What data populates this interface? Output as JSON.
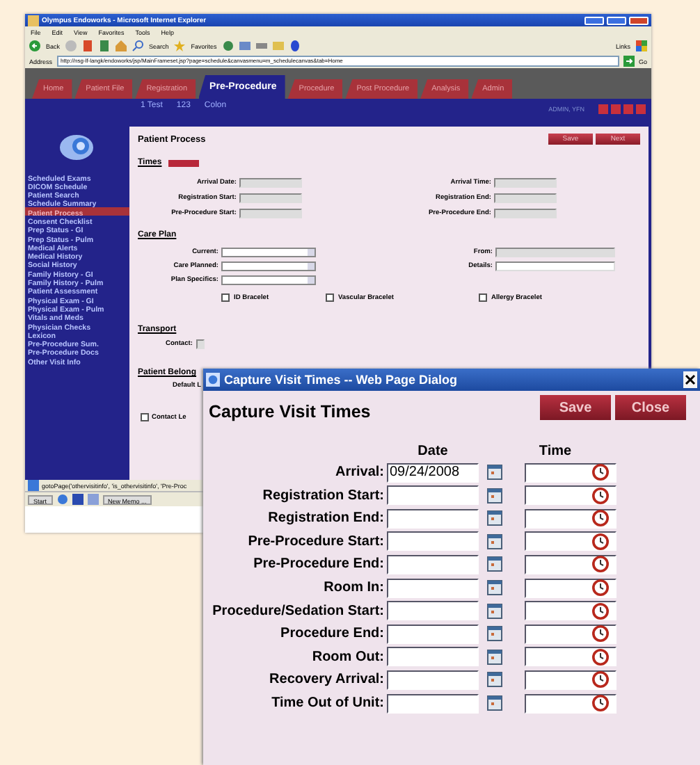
{
  "browser": {
    "title": "Olympus Endoworks - Microsoft Internet Explorer",
    "menu": [
      "File",
      "Edit",
      "View",
      "Favorites",
      "Tools",
      "Help"
    ],
    "toolbar": {
      "back": "Back",
      "search": "Search",
      "favorites": "Favorites",
      "links": "Links"
    },
    "address": {
      "label": "Address",
      "url": "http://nsg-lf-langk/endoworks/jsp/MainFrameset.jsp?page=schedule&canvasmenu=m_schedulecanvas&tab=Home",
      "go": "Go"
    },
    "tabs": [
      {
        "label": "Home",
        "selected": false
      },
      {
        "label": "Patient File",
        "selected": false
      },
      {
        "label": "Registration",
        "selected": false
      },
      {
        "label": "Pre-Procedure",
        "selected": true
      },
      {
        "label": "Procedure",
        "selected": false
      },
      {
        "label": "Post Procedure",
        "selected": false
      },
      {
        "label": "Analysis",
        "selected": false
      },
      {
        "label": "Admin",
        "selected": false
      }
    ],
    "patient": [
      "1 Test",
      "123",
      "Colon"
    ],
    "user": "ADMIN, YFN",
    "sidebar": [
      {
        "label": "Scheduled Exams",
        "selected": false
      },
      {
        "label": "DICOM Schedule",
        "selected": false
      },
      {
        "label": "Patient Search",
        "selected": false
      },
      {
        "label": "Schedule Summary",
        "selected": false
      },
      {
        "label": "Patient Process",
        "selected": true
      },
      {
        "label": "Consent Checklist",
        "selected": false
      },
      {
        "label": "Prep Status - GI",
        "selected": false
      },
      {
        "label": "Prep Status - Pulm",
        "selected": false
      },
      {
        "label": "Medical Alerts",
        "selected": false
      },
      {
        "label": "Medical History",
        "selected": false
      },
      {
        "label": "Social History",
        "selected": false
      },
      {
        "label": "Family History - GI",
        "selected": false
      },
      {
        "label": "Family History - Pulm",
        "selected": false
      },
      {
        "label": "Patient Assessment",
        "selected": false
      },
      {
        "label": "Physical Exam - GI",
        "selected": false
      },
      {
        "label": "Physical Exam - Pulm",
        "selected": false
      },
      {
        "label": "Vitals and Meds",
        "selected": false
      },
      {
        "label": "Physician Checks",
        "selected": false
      },
      {
        "label": "Lexicon",
        "selected": false
      },
      {
        "label": "Pre-Procedure Sum.",
        "selected": false
      },
      {
        "label": "Pre-Procedure Docs",
        "selected": false
      },
      {
        "label": "Other Visit Info",
        "selected": false
      }
    ],
    "page_title": "Patient Process",
    "buttons": [
      "Save",
      "Next"
    ],
    "times": {
      "heading": "Times",
      "fields": [
        {
          "label": "Arrival Date:",
          "kind": "readonly"
        },
        {
          "label": "Arrival Time:",
          "kind": "readonly"
        },
        {
          "label": "Registration Start:",
          "kind": "readonly"
        },
        {
          "label": "Registration End:",
          "kind": "readonly"
        },
        {
          "label": "Pre-Procedure Start:",
          "kind": "readonly"
        },
        {
          "label": "Pre-Procedure End:",
          "kind": "readonly"
        }
      ]
    },
    "care_plan": {
      "heading": "Care Plan",
      "fields": [
        {
          "label": "Current:",
          "kind": "select"
        },
        {
          "label": "From:",
          "kind": "readonly"
        },
        {
          "label": "Care Planned:",
          "kind": "select"
        },
        {
          "label": "Details:",
          "kind": "text"
        },
        {
          "label": "Plan Specifics:",
          "kind": "select"
        }
      ],
      "checkboxes": [
        {
          "label": "ID Bracelet",
          "checked": false
        },
        {
          "label": "Vascular Bracelet",
          "checked": false
        },
        {
          "label": "Allergy Bracelet",
          "checked": false
        }
      ]
    },
    "transport": {
      "heading": "Transport",
      "field": "Contact:"
    },
    "belongings": {
      "heading": "Patient Belong",
      "field": "Default L"
    },
    "contact_checkbox": {
      "label": "Contact Le",
      "checked": false
    },
    "status_bar": "gotoPage('othervisitinfo', 'is_othervisitinfo', 'Pre-Proc",
    "taskbar": {
      "start": "Start",
      "window": "New Memo ..."
    }
  },
  "dialog": {
    "title": "Capture Visit Times -- Web Page Dialog",
    "heading": "Capture Visit Times",
    "buttons": [
      "Save",
      "Close"
    ],
    "columns": [
      "Date",
      "Time"
    ],
    "rows": [
      {
        "label": "Arrival:",
        "date": "09/24/2008"
      },
      {
        "label": "Registration Start:"
      },
      {
        "label": "Registration End:"
      },
      {
        "label": "Pre-Procedure Start:"
      },
      {
        "label": "Pre-Procedure End:"
      },
      {
        "label": "Room In:"
      },
      {
        "label": "Procedure/Sedation Start:"
      },
      {
        "label": "Procedure End:"
      },
      {
        "label": "Room Out:"
      },
      {
        "label": "Recovery Arrival:"
      },
      {
        "label": "Time Out of Unit:"
      }
    ]
  }
}
